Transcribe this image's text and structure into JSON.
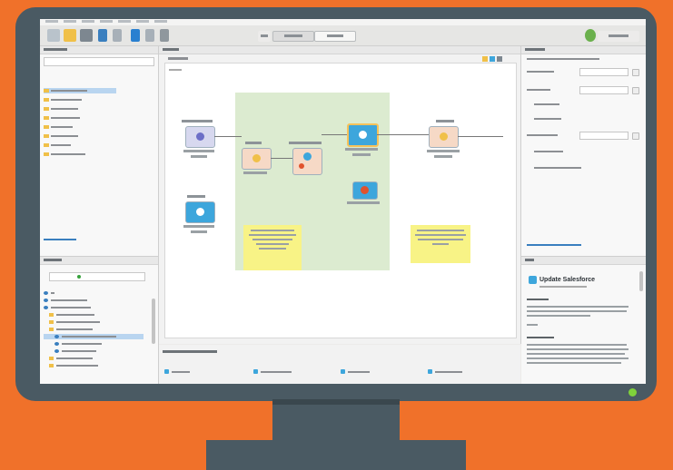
{
  "monitor": {
    "frame_color": "#4a5a63",
    "background_color": "#f0712a",
    "power_led_color": "#7fd13b"
  },
  "app": {
    "accent_blue": "#3da6dc",
    "process_zone_color": "#dcebd0",
    "note_color": "#f8f386",
    "selected_operator": {
      "help_title": "Update Salesforce"
    }
  }
}
